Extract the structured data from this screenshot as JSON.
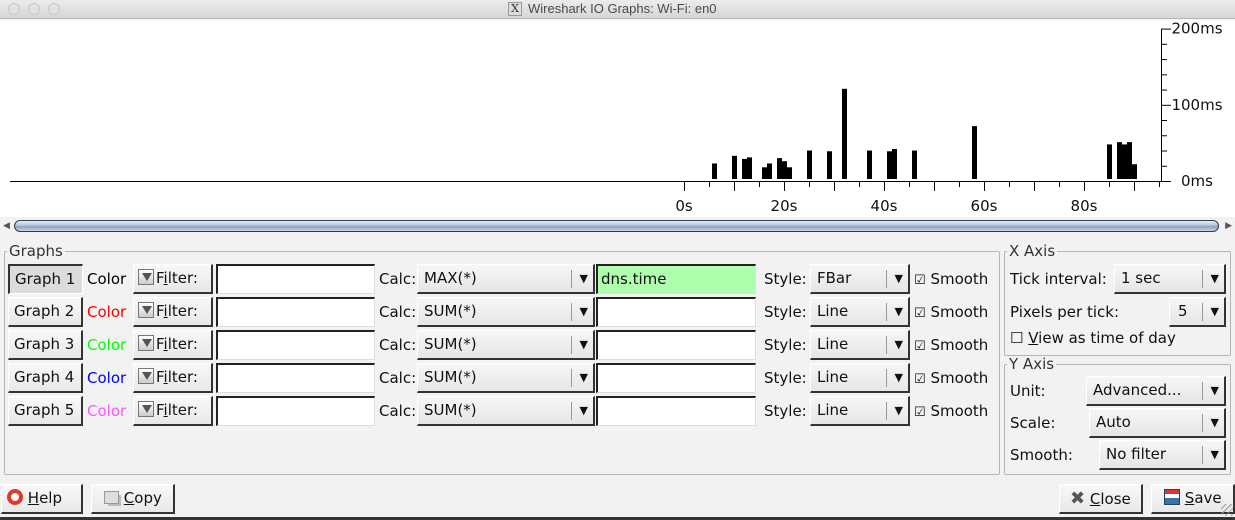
{
  "window": {
    "title": "Wireshark IO Graphs: Wi-Fi: en0",
    "title_icon": "x11-icon"
  },
  "chart_data": {
    "type": "bar",
    "style": "FBar",
    "title": "",
    "xlabel": "",
    "ylabel": "",
    "x_unit": "s",
    "y_unit": "ms",
    "xlim": [
      0,
      95
    ],
    "ylim": [
      0,
      200
    ],
    "x_ticks": [
      "0s",
      "20s",
      "40s",
      "60s",
      "80s"
    ],
    "x_tick_values": [
      0,
      20,
      40,
      60,
      80
    ],
    "y_ticks": [
      "0ms",
      "100ms",
      "200ms"
    ],
    "y_tick_values": [
      0,
      100,
      200
    ],
    "grid": false,
    "legend": "none",
    "series": [
      {
        "name": "Graph 1",
        "color": "#000000",
        "x": [
          6,
          10,
          12,
          13,
          16,
          17,
          19,
          20,
          21,
          25,
          29,
          32,
          37,
          41,
          42,
          46,
          58,
          85,
          87,
          88,
          89,
          90
        ],
        "values": [
          23,
          33,
          29,
          31,
          18,
          23,
          30,
          26,
          18,
          40,
          39,
          121,
          40,
          39,
          42,
          40,
          72,
          48,
          51,
          48,
          51,
          22
        ]
      }
    ]
  },
  "graphs_panel": {
    "legend": "Graphs",
    "color_label": "Color",
    "filter_label": "Filter:",
    "calc_label": "Calc:",
    "style_label": "Style:",
    "smooth_label": "Smooth",
    "rows": [
      {
        "button": "Graph 1",
        "color": "#000000",
        "filter": "",
        "calc": "MAX(*)",
        "calc_field": "dns.time",
        "style": "FBar",
        "smooth": true,
        "active": true
      },
      {
        "button": "Graph 2",
        "color": "#ff0000",
        "filter": "",
        "calc": "SUM(*)",
        "calc_field": "",
        "style": "Line",
        "smooth": true,
        "active": false
      },
      {
        "button": "Graph 3",
        "color": "#00ff00",
        "filter": "",
        "calc": "SUM(*)",
        "calc_field": "",
        "style": "Line",
        "smooth": true,
        "active": false
      },
      {
        "button": "Graph 4",
        "color": "#0000ff",
        "filter": "",
        "calc": "SUM(*)",
        "calc_field": "",
        "style": "Line",
        "smooth": true,
        "active": false
      },
      {
        "button": "Graph 5",
        "color": "#ff55ff",
        "filter": "",
        "calc": "SUM(*)",
        "calc_field": "",
        "style": "Line",
        "smooth": true,
        "active": false
      }
    ]
  },
  "x_axis": {
    "legend": "X Axis",
    "tick_interval_label": "Tick interval:",
    "tick_interval": "1 sec",
    "pixels_per_tick_label": "Pixels per tick:",
    "pixels_per_tick": "5",
    "time_of_day_label": "View as time of day",
    "time_of_day": false
  },
  "y_axis": {
    "legend": "Y Axis",
    "unit_label": "Unit:",
    "unit": "Advanced...",
    "scale_label": "Scale:",
    "scale": "Auto",
    "smooth_label": "Smooth:",
    "smooth": "No filter"
  },
  "footer": {
    "help": "Help",
    "copy": "Copy",
    "close": "Close",
    "save": "Save"
  }
}
